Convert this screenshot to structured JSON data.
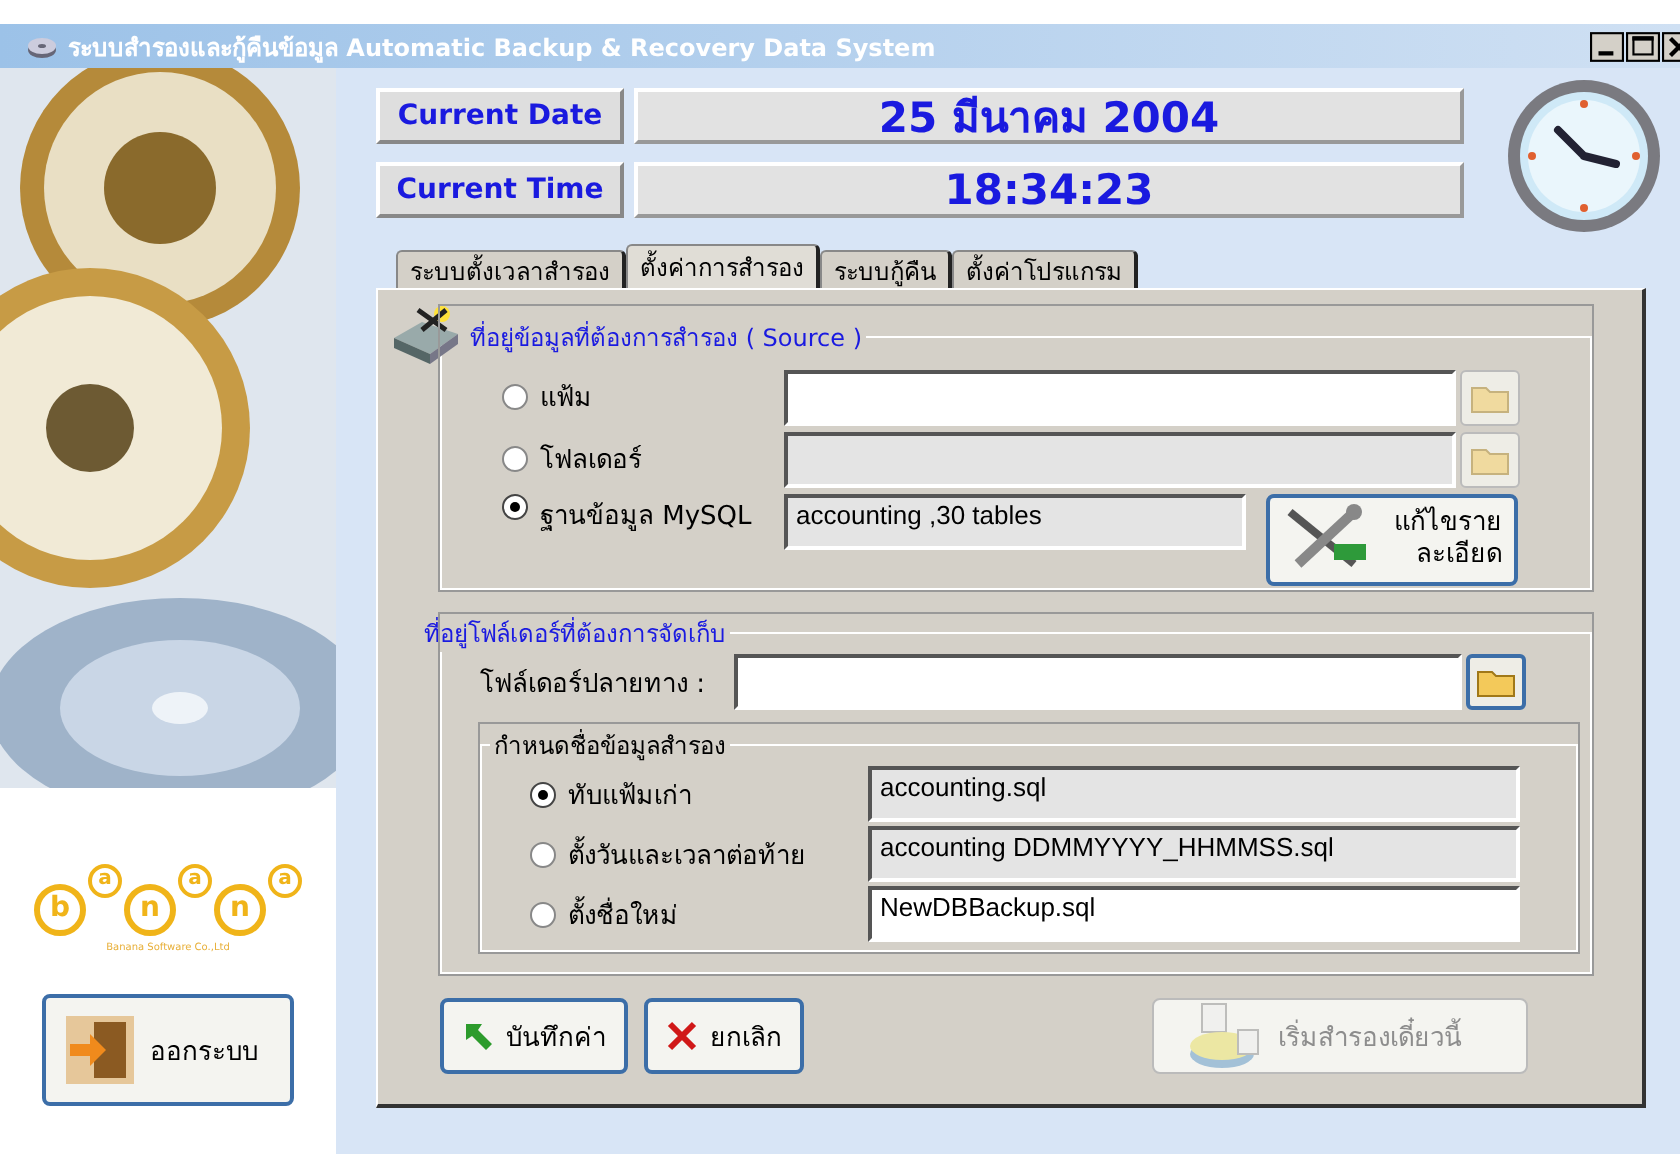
{
  "window": {
    "title": "ระบบสำรองและกู้คืนข้อมูล  Automatic Backup & Recovery Data System"
  },
  "header": [
    {
      "label": "Current Date",
      "value": "25 มีนาคม 2004"
    },
    {
      "label": "Current Time",
      "value": "18:34:23"
    }
  ],
  "tabs": [
    {
      "label": "ระบบตั้งเวลาสำรอง",
      "selected": false
    },
    {
      "label": "ตั้งค่าการสำรอง",
      "selected": true
    },
    {
      "label": "ระบบกู้คืน",
      "selected": false
    },
    {
      "label": "ตั้งค่าโปรแกรม",
      "selected": false
    }
  ],
  "source": {
    "title": "ที่อยู่ข้อมูลที่ต้องการสำรอง ( Source )",
    "options": [
      {
        "label": "แฟ้ม",
        "selected": false,
        "readonly": false,
        "browse": {
          "disabled": true
        }
      },
      {
        "label": "โฟลเดอร์",
        "selected": false,
        "readonly": true,
        "browse": {
          "disabled": true
        }
      },
      {
        "label": "ฐานข้อมูล MySQL",
        "selected": true,
        "value": "accounting ,30 tables",
        "readonly": true,
        "action": {
          "lines": [
            "แก้ไขราย",
            "ละเอียด"
          ]
        }
      }
    ]
  },
  "destination": {
    "title": "ที่อยู่โฟล์เดอร์ที่ต้องการจัดเก็บ",
    "label": "โฟล์เดอร์ปลายทาง :",
    "browse": {
      "disabled": false
    },
    "naming": {
      "title": "กำหนดชื่อข้อมูลสำรอง",
      "options": [
        {
          "label": "ทับแฟ้มเก่า",
          "selected": true,
          "value": "accounting.sql",
          "readonly": true
        },
        {
          "label": "ตั้งวันและเวลาต่อท้าย",
          "selected": false,
          "value": "accounting DDMMYYYY_HHMMSS.sql",
          "readonly": true
        },
        {
          "label": "ตั้งชื่อใหม่",
          "selected": false,
          "value": "NewDBBackup.sql",
          "readonly": false
        }
      ]
    }
  },
  "buttons": [
    {
      "kind": "save",
      "label": "บันทึกค่า",
      "disabled": false
    },
    {
      "kind": "cancel",
      "label": "ยกเลิก",
      "disabled": false
    },
    {
      "kind": "start",
      "label": "เริ่มสำรองเดี๋ยวนี้",
      "disabled": true
    }
  ],
  "logo": {
    "letters": [
      "b",
      "a",
      "n",
      "a",
      "n",
      "a"
    ],
    "company": "Banana Software Co.,Ltd"
  },
  "exit_button": {
    "label": "ออกระบบ"
  }
}
